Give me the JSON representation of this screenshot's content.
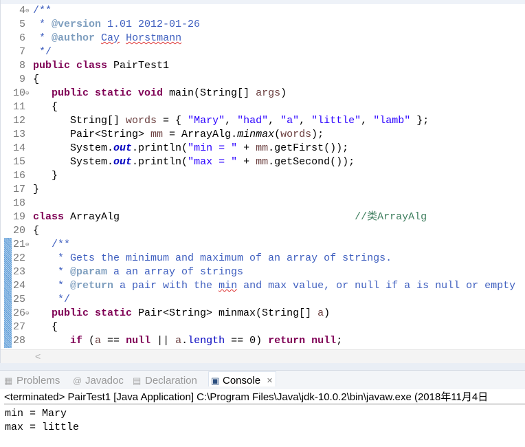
{
  "editor": {
    "lines": [
      {
        "n": "4",
        "fold": true,
        "tokens": [
          {
            "t": "/**",
            "c": "jd"
          }
        ]
      },
      {
        "n": "5",
        "tokens": [
          {
            "t": " * ",
            "c": "jd"
          },
          {
            "t": "@version",
            "c": "jt"
          },
          {
            "t": " 1.01 2012-01-26",
            "c": "jd"
          }
        ]
      },
      {
        "n": "6",
        "tokens": [
          {
            "t": " * ",
            "c": "jd"
          },
          {
            "t": "@author",
            "c": "jt"
          },
          {
            "t": " ",
            "c": "jd"
          },
          {
            "t": "Cay",
            "c": "jd sp"
          },
          {
            "t": " ",
            "c": "jd"
          },
          {
            "t": "Horstmann",
            "c": "jd sp"
          }
        ]
      },
      {
        "n": "7",
        "tokens": [
          {
            "t": " */",
            "c": "jd"
          }
        ]
      },
      {
        "n": "8",
        "tokens": [
          {
            "t": "public class ",
            "c": "kw"
          },
          {
            "t": "PairTest1",
            "c": "pl"
          }
        ]
      },
      {
        "n": "9",
        "tokens": [
          {
            "t": "{",
            "c": "pl"
          }
        ]
      },
      {
        "n": "10",
        "fold": true,
        "tokens": [
          {
            "t": "   public static void ",
            "c": "kw"
          },
          {
            "t": "main(String[] ",
            "c": "pl"
          },
          {
            "t": "args",
            "c": "var"
          },
          {
            "t": ")",
            "c": "pl"
          }
        ]
      },
      {
        "n": "11",
        "tokens": [
          {
            "t": "   {",
            "c": "pl"
          }
        ]
      },
      {
        "n": "12",
        "tokens": [
          {
            "t": "      String[] ",
            "c": "pl"
          },
          {
            "t": "words",
            "c": "var"
          },
          {
            "t": " = { ",
            "c": "pl"
          },
          {
            "t": "\"Mary\"",
            "c": "str"
          },
          {
            "t": ", ",
            "c": "pl"
          },
          {
            "t": "\"had\"",
            "c": "str"
          },
          {
            "t": ", ",
            "c": "pl"
          },
          {
            "t": "\"a\"",
            "c": "str"
          },
          {
            "t": ", ",
            "c": "pl"
          },
          {
            "t": "\"little\"",
            "c": "str"
          },
          {
            "t": ", ",
            "c": "pl"
          },
          {
            "t": "\"lamb\"",
            "c": "str"
          },
          {
            "t": " };",
            "c": "pl"
          }
        ]
      },
      {
        "n": "13",
        "tokens": [
          {
            "t": "      Pair<String> ",
            "c": "pl"
          },
          {
            "t": "mm",
            "c": "var"
          },
          {
            "t": " = ArrayAlg.",
            "c": "pl"
          },
          {
            "t": "minmax",
            "c": "sm"
          },
          {
            "t": "(",
            "c": "pl"
          },
          {
            "t": "words",
            "c": "var"
          },
          {
            "t": ");",
            "c": "pl"
          }
        ]
      },
      {
        "n": "14",
        "tokens": [
          {
            "t": "      System.",
            "c": "pl"
          },
          {
            "t": "out",
            "c": "fld"
          },
          {
            "t": ".println(",
            "c": "pl"
          },
          {
            "t": "\"min = \"",
            "c": "str"
          },
          {
            "t": " + ",
            "c": "pl"
          },
          {
            "t": "mm",
            "c": "var"
          },
          {
            "t": ".getFirst());",
            "c": "pl"
          }
        ]
      },
      {
        "n": "15",
        "tokens": [
          {
            "t": "      System.",
            "c": "pl"
          },
          {
            "t": "out",
            "c": "fld"
          },
          {
            "t": ".println(",
            "c": "pl"
          },
          {
            "t": "\"max = \"",
            "c": "str"
          },
          {
            "t": " + ",
            "c": "pl"
          },
          {
            "t": "mm",
            "c": "var"
          },
          {
            "t": ".getSecond());",
            "c": "pl"
          }
        ]
      },
      {
        "n": "16",
        "tokens": [
          {
            "t": "   }",
            "c": "pl"
          }
        ]
      },
      {
        "n": "17",
        "tokens": [
          {
            "t": "}",
            "c": "pl"
          }
        ]
      },
      {
        "n": "18",
        "tokens": []
      },
      {
        "n": "19",
        "tokens": [
          {
            "t": "class ",
            "c": "kw"
          },
          {
            "t": "ArrayAlg                                      ",
            "c": "pl"
          },
          {
            "t": "//类ArrayAlg",
            "c": "cm"
          }
        ]
      },
      {
        "n": "20",
        "tokens": [
          {
            "t": "{",
            "c": "pl"
          }
        ]
      },
      {
        "n": "21",
        "fold": true,
        "changed": true,
        "tokens": [
          {
            "t": "   /**",
            "c": "jd"
          }
        ]
      },
      {
        "n": "22",
        "changed": true,
        "tokens": [
          {
            "t": "    * Gets the minimum and maximum of an array of strings.",
            "c": "jd"
          }
        ]
      },
      {
        "n": "23",
        "changed": true,
        "tokens": [
          {
            "t": "    * ",
            "c": "jd"
          },
          {
            "t": "@param",
            "c": "jt"
          },
          {
            "t": " a an array of strings",
            "c": "jd"
          }
        ]
      },
      {
        "n": "24",
        "changed": true,
        "tokens": [
          {
            "t": "    * ",
            "c": "jd"
          },
          {
            "t": "@return",
            "c": "jt"
          },
          {
            "t": " a pair with the ",
            "c": "jd"
          },
          {
            "t": "min",
            "c": "jd sp"
          },
          {
            "t": " and max value, or null if a is null or empty",
            "c": "jd"
          }
        ]
      },
      {
        "n": "25",
        "changed": true,
        "tokens": [
          {
            "t": "    */",
            "c": "jd"
          }
        ]
      },
      {
        "n": "26",
        "fold": true,
        "changed": true,
        "tokens": [
          {
            "t": "   public static ",
            "c": "kw"
          },
          {
            "t": "Pair<String> minmax(String[] ",
            "c": "pl"
          },
          {
            "t": "a",
            "c": "var"
          },
          {
            "t": ")",
            "c": "pl"
          }
        ]
      },
      {
        "n": "27",
        "changed": true,
        "tokens": [
          {
            "t": "   {",
            "c": "pl"
          }
        ]
      },
      {
        "n": "28",
        "changed": true,
        "tokens": [
          {
            "t": "      if",
            "c": "kw"
          },
          {
            "t": " (",
            "c": "pl"
          },
          {
            "t": "a",
            "c": "var"
          },
          {
            "t": " == ",
            "c": "pl"
          },
          {
            "t": "null",
            "c": "kw"
          },
          {
            "t": " || ",
            "c": "pl"
          },
          {
            "t": "a",
            "c": "var"
          },
          {
            "t": ".",
            "c": "pl"
          },
          {
            "t": "length",
            "c": "fd"
          },
          {
            "t": " == 0) ",
            "c": "pl"
          },
          {
            "t": "return null",
            "c": "kw"
          },
          {
            "t": ";",
            "c": "pl"
          }
        ]
      }
    ],
    "scroll_left_icon": "chevron-left-icon"
  },
  "panel": {
    "tabs": [
      {
        "label": "Problems",
        "icon": "problems-icon",
        "active": false
      },
      {
        "label": "Javadoc",
        "icon": "javadoc-icon",
        "active": false
      },
      {
        "label": "Declaration",
        "icon": "declaration-icon",
        "active": false
      },
      {
        "label": "Console",
        "icon": "console-icon",
        "active": true
      }
    ],
    "console": {
      "header": "<terminated> PairTest1 [Java Application] C:\\Program Files\\Java\\jdk-10.0.2\\bin\\javaw.exe (2018年11月4日",
      "output": [
        "min = Mary",
        "max = little"
      ]
    }
  }
}
